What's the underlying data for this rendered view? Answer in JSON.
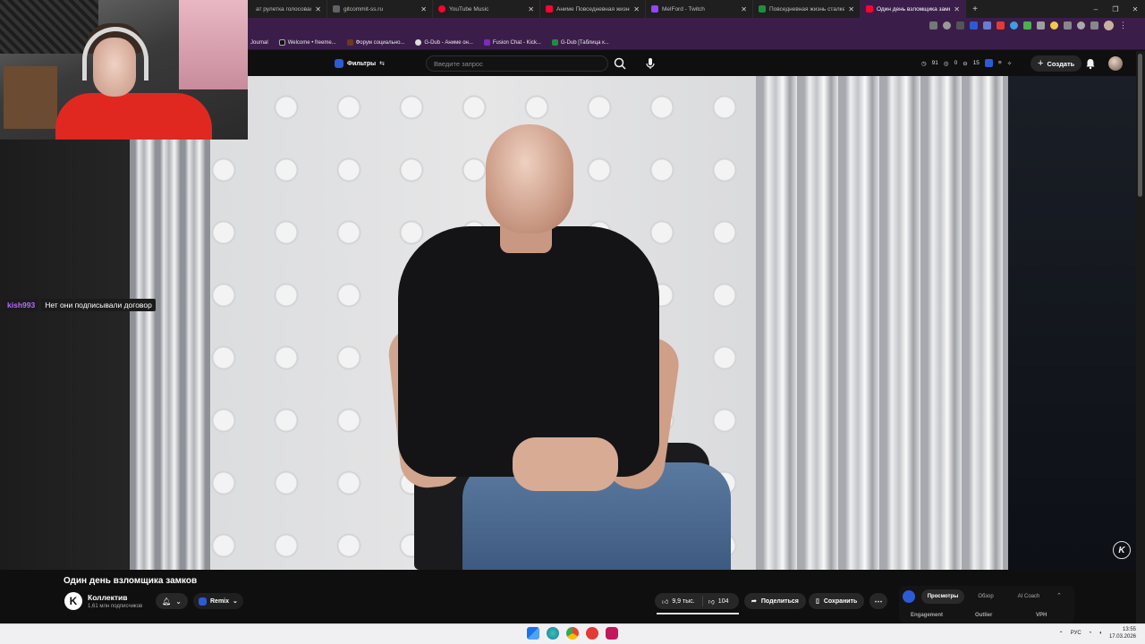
{
  "browser": {
    "tabs": [
      {
        "label": "ат рулетка голосовая — Ne",
        "active": false,
        "color": "#3c3c3c"
      },
      {
        "label": "gitcommit-ss.ru",
        "active": false,
        "color": "#5f6368"
      },
      {
        "label": "YouTube Music",
        "active": false,
        "color": "#ff0033"
      },
      {
        "label": "Аниме Повседневная жизнь ста",
        "active": false,
        "color": "#ff0033"
      },
      {
        "label": "MelFord - Twitch",
        "active": false,
        "color": "#9146ff"
      },
      {
        "label": "Повседневная жизнь сталкера м",
        "active": false,
        "color": "#1e8e3e"
      },
      {
        "label": "Один день взломщика замков -",
        "active": true,
        "color": "#ff0033"
      }
    ],
    "new_tab": "+",
    "window_controls": [
      "–",
      "❐",
      "✕"
    ],
    "bookmarks": [
      {
        "label": "Journal",
        "color": "#444"
      },
      {
        "label": "Welcome • freeme...",
        "color": "#111"
      },
      {
        "label": "Форум социально...",
        "color": "#6b3a1e"
      },
      {
        "label": "G-Dub - Аниме он...",
        "color": "#333"
      },
      {
        "label": "Fusion Chat - Kick...",
        "color": "#7b2cbf"
      },
      {
        "label": "G-Dub [Таблица к...",
        "color": "#1e8e3e"
      }
    ]
  },
  "masthead": {
    "filters_label": "Фильтры",
    "search_placeholder": "Введите запрос",
    "stats": [
      "91",
      "0",
      "15"
    ],
    "create_label": "Создать"
  },
  "chat": {
    "user": "kish993",
    "message": "Нет они подписывали договор"
  },
  "video": {
    "title": "Один день взломщика замков",
    "watermark": "K"
  },
  "channel": {
    "avatar_letter": "K",
    "name": "Коллектив",
    "subscribers": "1,61 млн подписчиков",
    "remix_label": "Remix"
  },
  "actions": {
    "likes": "9,9 тыс.",
    "dislikes": "104",
    "share": "Поделиться",
    "save": "Сохранить",
    "more": "⋯"
  },
  "side_panel": {
    "tabs": [
      "Просмотры",
      "Обзор",
      "AI Coach"
    ],
    "columns": [
      "Engagement",
      "Outlier",
      "VPH"
    ]
  },
  "taskbar": {
    "language": "РУС",
    "time": "13:55",
    "date": "17.03.2026"
  },
  "colors": {
    "accent": "#3b1d4a",
    "youtube_red": "#ff0033",
    "chat_user": "#b36bff",
    "ext_blue": "#2d5bd6"
  }
}
